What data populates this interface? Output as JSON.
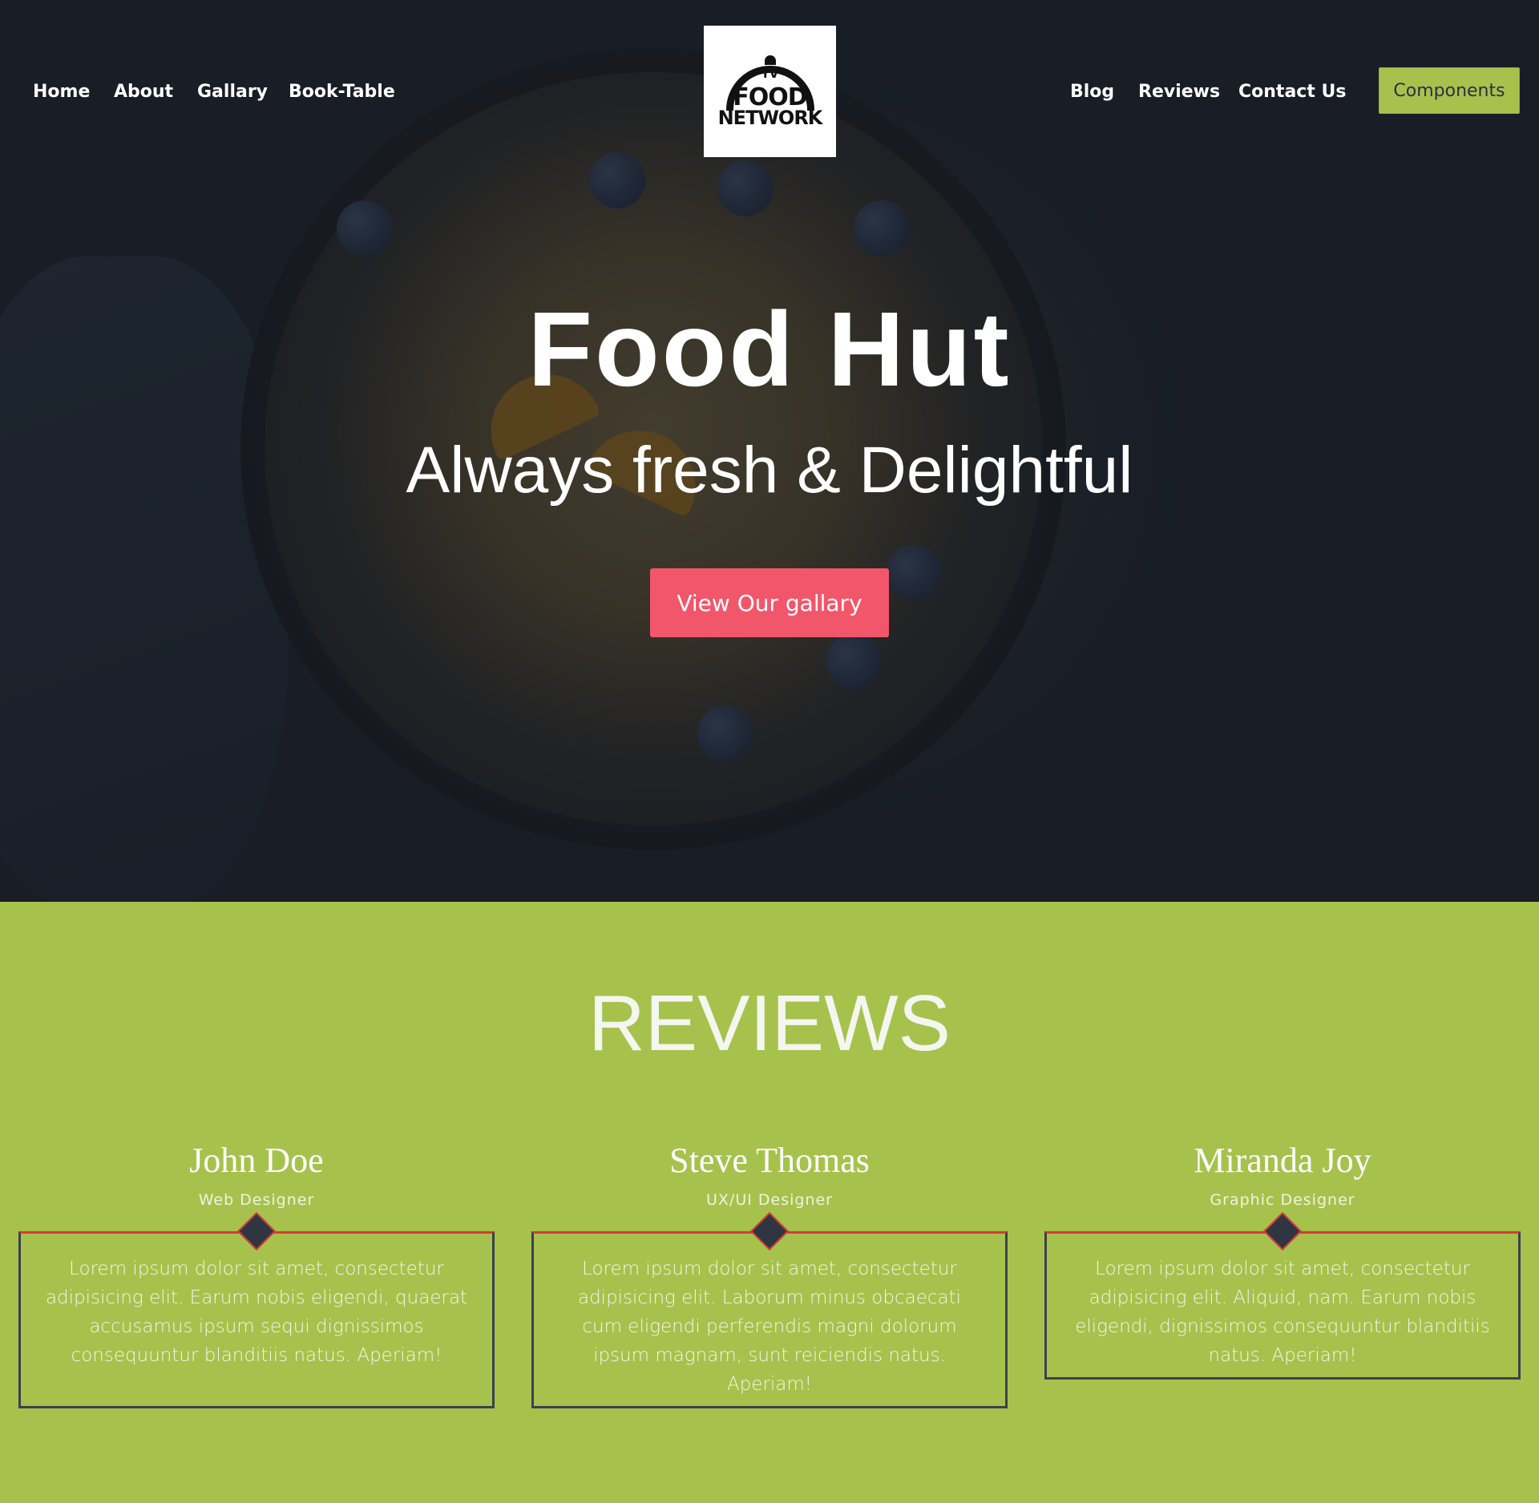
{
  "nav": {
    "left_links": [
      "Home",
      "About",
      "Gallary",
      "Book-Table"
    ],
    "right_links": [
      "Blog",
      "Reviews",
      "Contact Us"
    ],
    "logo": {
      "line1": "TV",
      "line2": "FOOD",
      "line3": "NETWORK"
    },
    "components_label": "Components"
  },
  "hero": {
    "title": "Food Hut",
    "subtitle": "Always fresh & Delightful",
    "cta_label": "View Our gallary"
  },
  "reviews": {
    "heading": "REVIEWS",
    "items": [
      {
        "name": "John Doe",
        "role": "Web Designer",
        "text": "Lorem ipsum dolor sit amet, consectetur adipisicing elit. Earum nobis eligendi, quaerat accusamus ipsum sequi dignissimos consequuntur blanditiis natus. Aperiam!"
      },
      {
        "name": "Steve Thomas",
        "role": "UX/UI Designer",
        "text": "Lorem ipsum dolor sit amet, consectetur adipisicing elit. Laborum minus obcaecati cum eligendi perferendis magni dolorum ipsum magnam, sunt reiciendis natus. Aperiam!"
      },
      {
        "name": "Miranda Joy",
        "role": "Graphic Designer",
        "text": "Lorem ipsum dolor sit amet, consectetur adipisicing elit. Aliquid, nam. Earum nobis eligendi, dignissimos consequuntur blanditiis natus. Aperiam!"
      }
    ]
  },
  "colors": {
    "accent_green": "#a6c24d",
    "cta_pink": "#f2566b",
    "card_border": "#3a4150",
    "card_top_border": "#d83a3a"
  },
  "icons": {
    "logo": "food-network-cloche-icon",
    "card_marker": "diamond-icon"
  }
}
